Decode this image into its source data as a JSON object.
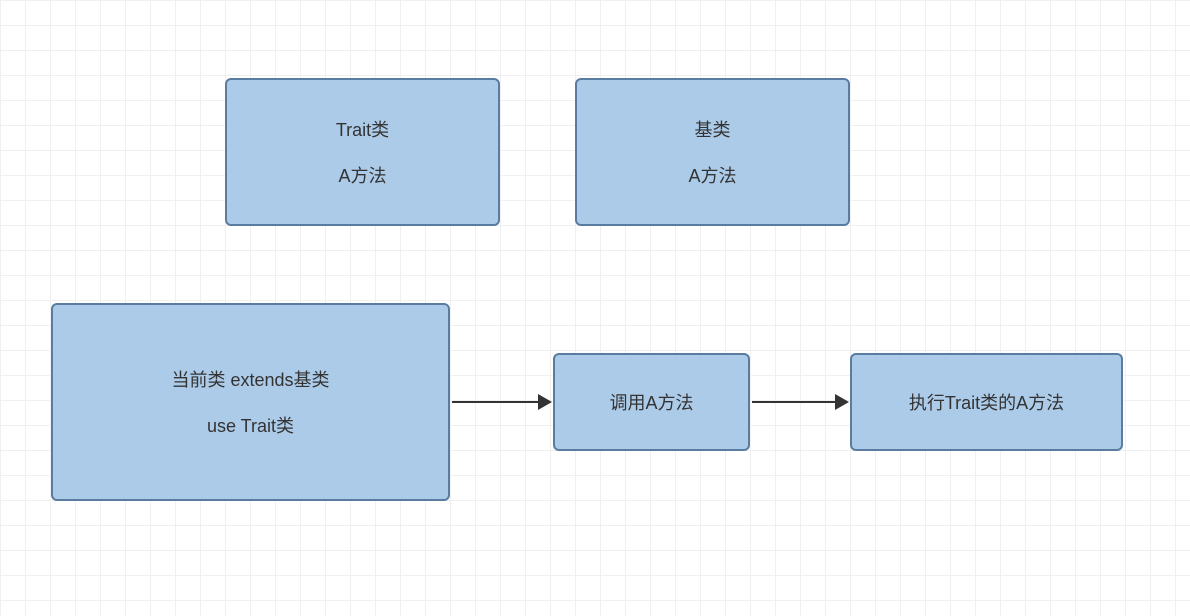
{
  "nodes": {
    "trait": {
      "line1": "Trait类",
      "line2": "A方法"
    },
    "base": {
      "line1": "基类",
      "line2": "A方法"
    },
    "current": {
      "line1": "当前类 extends基类",
      "line2": "use Trait类"
    },
    "call": {
      "label": "调用A方法"
    },
    "exec": {
      "label": "执行Trait类的A方法"
    }
  }
}
